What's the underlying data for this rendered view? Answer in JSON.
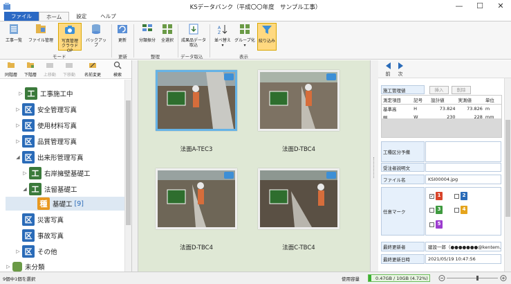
{
  "window": {
    "title": "KSデータバンク（平成〇〇年度　サンプル工事）",
    "min": "—",
    "max": "☐",
    "close": "✕"
  },
  "tabs": [
    "ファイル",
    "ホーム",
    "設定",
    "ヘルプ"
  ],
  "ribbon": {
    "buttons": [
      {
        "label1": "工事一覧",
        "label2": ""
      },
      {
        "label1": "ファイル管理",
        "label2": ""
      },
      {
        "label1": "写真管理",
        "label2": "クラウドOP"
      },
      {
        "label1": "バックアップ",
        "label2": ""
      },
      {
        "label1": "更新",
        "label2": ""
      },
      {
        "label1": "分類振分",
        "label2": ""
      },
      {
        "label1": "全選択",
        "label2": ""
      },
      {
        "label1": "成果品データ",
        "label2": "取込"
      },
      {
        "label1": "並べ替え",
        "label2": "▾"
      },
      {
        "label1": "グループ化",
        "label2": "▾"
      },
      {
        "label1": "絞り込み",
        "label2": ""
      }
    ],
    "groups": [
      "モード",
      "更新",
      "整理",
      "データ取込",
      "表示"
    ]
  },
  "toolbar": [
    "同階層",
    "下階層",
    "上移動",
    "下移動",
    "名前変更",
    "検索"
  ],
  "tree": [
    {
      "badge": "工",
      "label": "工事施工中"
    },
    {
      "badge": "区",
      "label": "安全管理写真"
    },
    {
      "badge": "区",
      "label": "使用材料写真"
    },
    {
      "badge": "区",
      "label": "品質管理写真"
    },
    {
      "badge": "区",
      "label": "出来形管理写真"
    },
    {
      "badge": "工",
      "label": "右岸擁壁基礎工"
    },
    {
      "badge": "工",
      "label": "法留基礎工"
    },
    {
      "badge": "種",
      "label": "基礎工",
      "count": "[9]"
    },
    {
      "badge": "区",
      "label": "災害写真"
    },
    {
      "badge": "区",
      "label": "事故写真"
    },
    {
      "badge": "区",
      "label": "その他"
    },
    {
      "badge": "",
      "label": "未分類"
    }
  ],
  "photos": [
    {
      "label": "法面A-TEC3"
    },
    {
      "label": "法面D-TBC4"
    },
    {
      "label": "法面D-TBC4"
    },
    {
      "label": "法面C-TBC4"
    }
  ],
  "details": {
    "nav_prev": "前",
    "nav_next": "次",
    "construction_mgmt": "施工管理値",
    "insert_btn": "挿入",
    "delete_btn": "削除",
    "meas_headers": [
      "測定項目",
      "記号",
      "設計値",
      "実測値",
      "単位"
    ],
    "meas_rows": [
      [
        "基準高",
        "H",
        "73.824",
        "73.826",
        "m"
      ],
      [
        "幅",
        "W",
        "230",
        "228",
        "mm"
      ]
    ],
    "work_type_label": "工種区分予備",
    "contractor_desc_label": "受注者説明文",
    "filename_label": "ファイル名",
    "filename": "KSI00004.jpg",
    "marks_label": "任意マーク",
    "marks": [
      "1",
      "2",
      "3",
      "4",
      "5"
    ],
    "updated_by_label": "最終更新者",
    "updated_by": "建設一郎（●●●●●●●@kentem.c",
    "updated_at_label": "最終更新日時",
    "updated_at": "2021/05/19 10:47:56"
  },
  "status": {
    "selection": "9個中1個を選択",
    "usage_label": "使用容量",
    "usage_text": "0.47GB / 10GB (4.72%)",
    "usage_percent": 4.72
  },
  "colors": {
    "accent": "#2b69c4",
    "badge_ku": "#2a6bb8",
    "badge_ko": "#3b7a3b",
    "badge_shu": "#e89820",
    "gallery_bg": "#dfe8d5"
  }
}
